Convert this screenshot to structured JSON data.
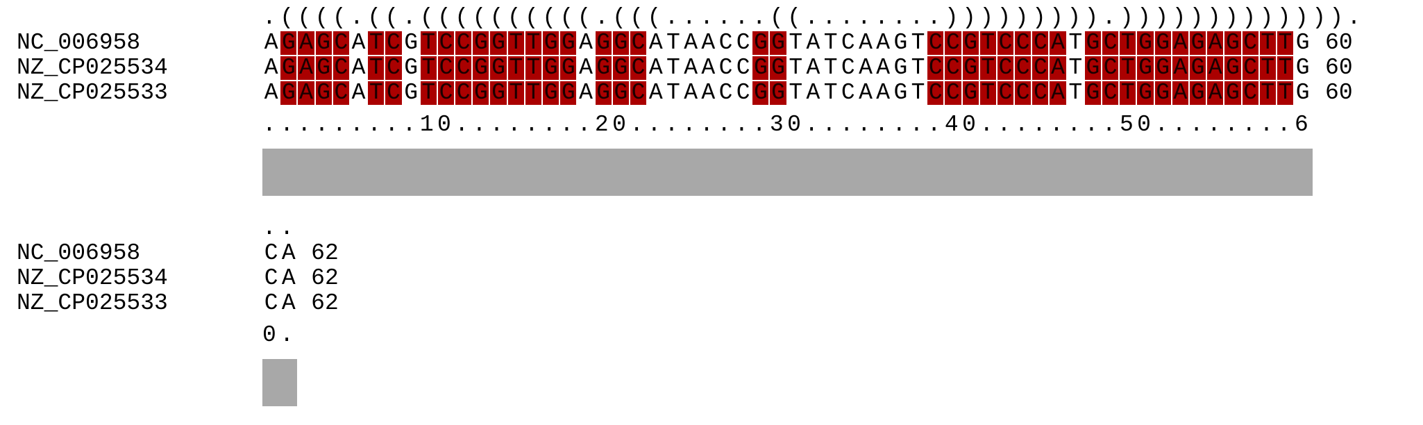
{
  "blocks": [
    {
      "structure": ".((((.((.((((((((((.(((......((........))))))))).))))))))))))).",
      "names": [
        "NC_006958",
        "NZ_CP025534",
        "NZ_CP025533"
      ],
      "sequences": [
        "AGAGCATCGTCCGGTTGGAGGCATAACCGGTATCAAGTCCGTCCCATGCTGGAGAGCTTG",
        "AGAGCATCGTCCGGTTGGAGGCATAACCGGTATCAAGTCCGTCCCATGCTGGAGAGCTTG",
        "AGAGCATCGTCCGGTTGGAGGCATAACCGGTATCAAGTCCGTCCCATGCTGGAGAGCTTG"
      ],
      "end_positions": [
        "60",
        "60",
        "60"
      ],
      "ruler": ".........10........20........30........40........50........6",
      "highlighted_columns": [
        1,
        2,
        3,
        4,
        6,
        7,
        9,
        10,
        11,
        12,
        13,
        14,
        15,
        16,
        17,
        19,
        20,
        21,
        28,
        29,
        38,
        39,
        40,
        41,
        42,
        43,
        44,
        45,
        47,
        48,
        49,
        50,
        51,
        52,
        53,
        54,
        55,
        56,
        57,
        58
      ],
      "conservation_columns": 60
    },
    {
      "structure": "..",
      "names": [
        "NC_006958",
        "NZ_CP025534",
        "NZ_CP025533"
      ],
      "sequences": [
        "CA",
        "CA",
        "CA"
      ],
      "end_positions": [
        "62",
        "62",
        "62"
      ],
      "ruler": "0.",
      "highlighted_columns": [],
      "conservation_columns": 2
    }
  ],
  "colors": {
    "pair_highlight": "#aa0000",
    "conservation_bar": "#a8a8a8",
    "text": "#000000"
  }
}
